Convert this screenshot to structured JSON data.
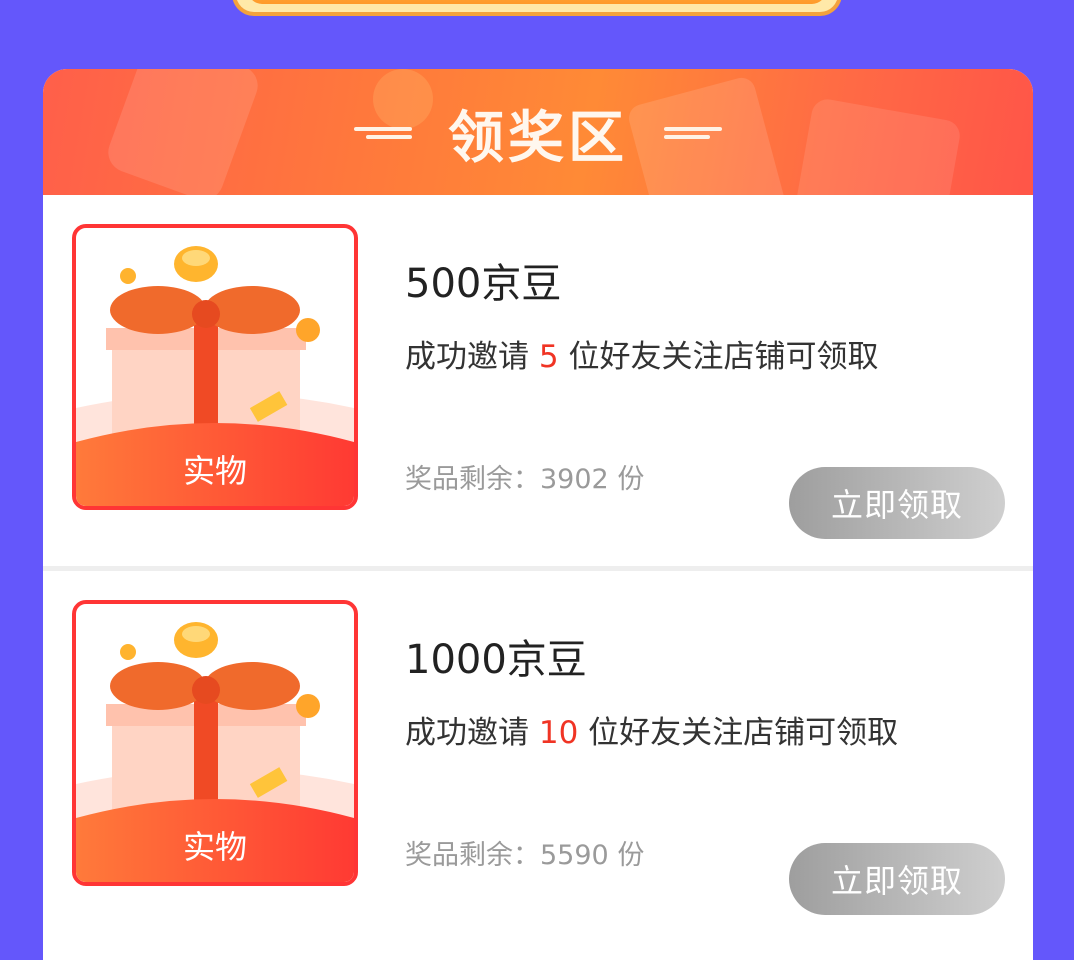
{
  "header": {
    "title": "领奖区"
  },
  "prizes": [
    {
      "name": "500京豆",
      "badge": "实物",
      "desc_prefix": "成功邀请",
      "desc_count": "5",
      "desc_suffix": "位好友关注店铺可领取",
      "remain_label": "奖品剩余：",
      "remain_count": "3902",
      "remain_unit": "份",
      "button": "立即领取"
    },
    {
      "name": "1000京豆",
      "badge": "实物",
      "desc_prefix": "成功邀请",
      "desc_count": "10",
      "desc_suffix": "位好友关注店铺可领取",
      "remain_label": "奖品剩余：",
      "remain_count": "5590",
      "remain_unit": "份",
      "button": "立即领取"
    }
  ],
  "colors": {
    "page_bg": "#6457fb",
    "accent_red": "#f03424",
    "button_gray": "#b0b0b0"
  },
  "icons": [
    "gift-box-icon",
    "gold-ingot-icon",
    "coin-icon",
    "gold-bar-icon"
  ]
}
